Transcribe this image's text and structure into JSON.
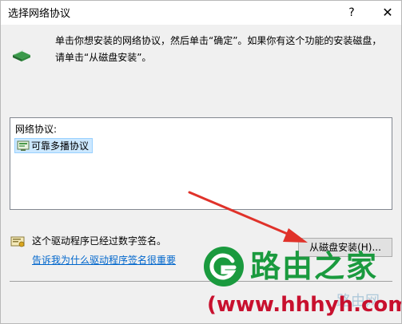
{
  "window": {
    "title": "选择网络协议",
    "help_glyph": "?",
    "close_glyph": "✕"
  },
  "instruction": {
    "text": "单击你想安装的网络协议，然后单击“确定”。如果你有这个功能的安装磁盘，请单击“从磁盘安装”。",
    "icon": "network-protocol-icon"
  },
  "protocol_list": {
    "label": "网络协议:",
    "items": [
      {
        "label": "可靠多播协议",
        "icon": "protocol-icon",
        "selected": true
      }
    ]
  },
  "signature": {
    "text": "这个驱动程序已经过数字签名。",
    "link": "告诉我为什么驱动程序签名很重要",
    "icon": "signed-driver-icon"
  },
  "buttons": {
    "have_disk": "从磁盘安装(H)..."
  },
  "watermark": {
    "brand": "路由之家",
    "url": "(www.hhhyh.com",
    "faint": "路由网"
  },
  "colors": {
    "arrow": "#e0322a",
    "brand": "#1a9a3e",
    "url": "#c8102e",
    "link": "#0066cc",
    "selection": "#cce8ff"
  }
}
